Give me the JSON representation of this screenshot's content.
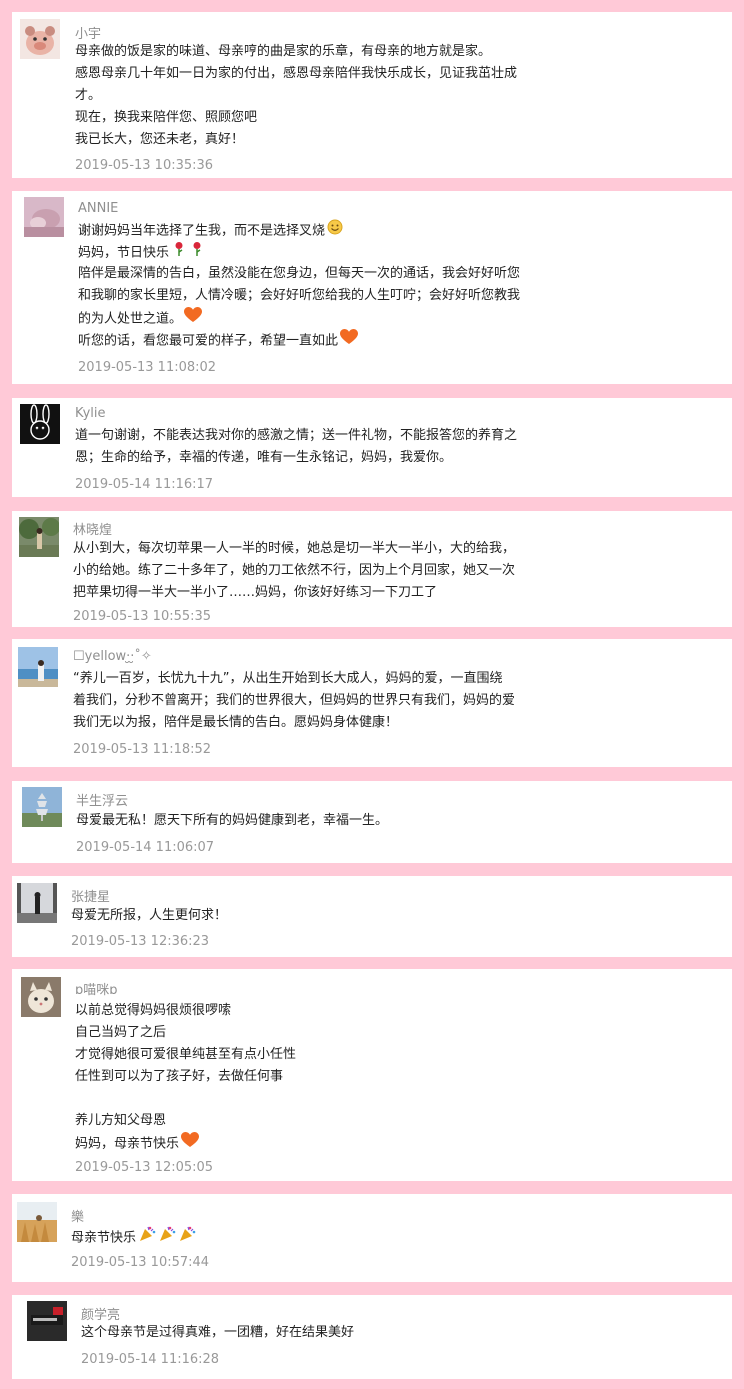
{
  "comments": [
    {
      "name": "小宇",
      "lines": [
        "母亲做的饭是家的味道、母亲哼的曲是家的乐章，有母亲的地方就是家。",
        "感恩母亲几十年如一日为家的付出，感恩母亲陪伴我快乐成长，见证我茁壮成",
        "才。",
        "现在，换我来陪伴您、照顾您吧",
        "我已长大，您还未老，真好！"
      ],
      "time": "2019-05-13 10:35:36",
      "avatar": "pig-avatar-icon"
    },
    {
      "name": "ANNIE",
      "lines": [
        "谢谢妈妈当年选择了生我，而不是选择叉烧",
        "妈妈，节日快乐",
        "陪伴是最深情的告白，虽然没能在您身边，但每天一次的通话，我会好好听您",
        "和我聊的家长里短，人情冷暖；会好好听您给我的人生叮咛；会好好听您教我",
        "的为人处世之道。",
        "听您的话，看您最可爱的样子，希望一直如此"
      ],
      "time": "2019-05-13 11:08:02",
      "avatar": "photo-avatar-icon"
    },
    {
      "name": "Kylie",
      "lines": [
        "道一句谢谢，不能表达我对你的感激之情；送一件礼物，不能报答您的养育之",
        "恩；生命的给予，幸福的传递，唯有一生永铭记，妈妈，我爱你。"
      ],
      "time": "2019-05-14 11:16:17",
      "avatar": "rabbit-avatar-icon"
    },
    {
      "name": "林晓煌",
      "lines": [
        "从小到大，每次切苹果一人一半的时候，她总是切一半大一半小，大的给我，",
        "小的给她。练了二十多年了，她的刀工依然不行，因为上个月回家，她又一次",
        "把苹果切得一半大一半小了……妈妈，你该好好练习一下刀工了"
      ],
      "time": "2019-05-13 10:55:35",
      "avatar": "garden-avatar-icon"
    },
    {
      "name": "☐yellow·̮·̮˚✧",
      "lines": [
        "“养儿一百岁，长忧九十九”，从出生开始到长大成人，妈妈的爱，一直围绕",
        "着我们，分秒不曾离开；我们的世界很大，但妈妈的世界只有我们，妈妈的爱",
        "我们无以为报，陪伴是最长情的告白。愿妈妈身体健康！"
      ],
      "time": "2019-05-13 11:18:52",
      "avatar": "beach-avatar-icon"
    },
    {
      "name": "半生浮云",
      "lines": [
        "母爱最无私！愿天下所有的妈妈健康到老，幸福一生。"
      ],
      "time": "2019-05-14 11:06:07",
      "avatar": "pagoda-avatar-icon"
    },
    {
      "name": "张捷星",
      "lines": [
        "母爱无所报，人生更何求！"
      ],
      "time": "2019-05-13 12:36:23",
      "avatar": "silhouette-avatar-icon"
    },
    {
      "name": "ɒ喵咪ɒ",
      "lines": [
        "以前总觉得妈妈很烦很啰嗦",
        "自己当妈了之后",
        "才觉得她很可爱很单纯甚至有点小任性",
        "任性到可以为了孩子好，去做任何事",
        "",
        "养儿方知父母恩",
        "妈妈，母亲节快乐"
      ],
      "time": "2019-05-13 12:05:05",
      "avatar": "cat-avatar-icon"
    },
    {
      "name": "樂",
      "lines": [
        "母亲节快乐"
      ],
      "time": "2019-05-13 10:57:44",
      "avatar": "field-avatar-icon"
    },
    {
      "name": "颜学亮",
      "lines": [
        "这个母亲节是过得真难，一团糟，好在结果美好"
      ],
      "time": "2019-05-14 11:16:28",
      "avatar": "dark-logo-avatar-icon"
    }
  ],
  "colors": {
    "background": "#ffc9d7",
    "card": "#ffffff",
    "name": "#8f8f8f",
    "time": "#999999"
  }
}
